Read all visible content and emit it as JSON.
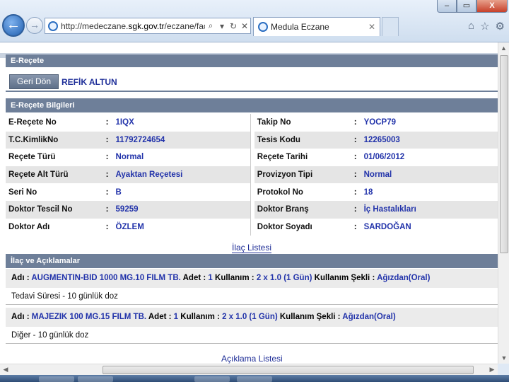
{
  "browser": {
    "url_prefix": "http://medeczane.",
    "url_domain": "sgk.gov.tr",
    "url_suffix": "/eczane/faces/",
    "tab_title": "Medula Eczane",
    "tab_close": "✕",
    "back_glyph": "←",
    "forward_glyph": "→",
    "search_glyph": "⌕",
    "dropdown_glyph": "▾",
    "refresh_glyph": "↻",
    "stop_glyph": "✕",
    "home_glyph": "⌂",
    "favorites_glyph": "☆",
    "tools_glyph": "⚙",
    "win_min": "–",
    "win_max": "▭",
    "win_close": "X"
  },
  "page": {
    "title": "E-Reçete",
    "back_button": "Geri Dön",
    "patient_name": "REFİK ALTUN",
    "info_section_title": "E-Reçete Bilgileri",
    "info_rows": [
      {
        "l1": "E-Reçete No",
        "v1": "1IQX",
        "l2": "Takip No",
        "v2": "YOCP79"
      },
      {
        "l1": "T.C.KimlikNo",
        "v1": "11792724654",
        "l2": "Tesis Kodu",
        "v2": "12265003"
      },
      {
        "l1": "Reçete Türü",
        "v1": "Normal",
        "l2": "Reçete Tarihi",
        "v2": "01/06/2012"
      },
      {
        "l1": "Reçete Alt Türü",
        "v1": "Ayaktan Reçetesi",
        "l2": "Provizyon Tipi",
        "v2": "Normal"
      },
      {
        "l1": "Seri No",
        "v1": "B",
        "l2": "Protokol No",
        "v2": "18"
      },
      {
        "l1": "Doktor Tescil No",
        "v1": "59259",
        "l2": "Doktor Branş",
        "v2": "İç Hastalıkları"
      },
      {
        "l1": "Doktor Adı",
        "v1": "ÖZLEM",
        "l2": "Doktor Soyadı",
        "v2": "SARDOĞAN"
      }
    ],
    "colon": ":",
    "drug_list_link": "İlaç Listesi",
    "drugs_section_title": "İlaç ve Açıklamalar",
    "drugs": [
      {
        "name_label": "Adı :",
        "name": "AUGMENTIN-BID 1000 MG.10 FILM TB.",
        "qty_label": "Adet :",
        "qty": "1",
        "usage_label": "Kullanım :",
        "usage": "2 x 1.0 (1 Gün)",
        "method_label": "Kullanım Şekli :",
        "method": "Ağızdan(Oral)",
        "note": "Tedavi Süresi - 10 günlük doz"
      },
      {
        "name_label": "Adı :",
        "name": "MAJEZIK 100 MG.15 FILM TB.",
        "qty_label": "Adet :",
        "qty": "1",
        "usage_label": "Kullanım :",
        "usage": "2 x 1.0 (1 Gün)",
        "method_label": "Kullanım Şekli :",
        "method": "Ağızdan(Oral)",
        "note": "Diğer - 10 günlük doz"
      }
    ],
    "explanation_link": "Açıklama Listesi"
  },
  "scrollbars": {
    "up": "▲",
    "down": "▼",
    "left": "◀",
    "right": "▶"
  }
}
